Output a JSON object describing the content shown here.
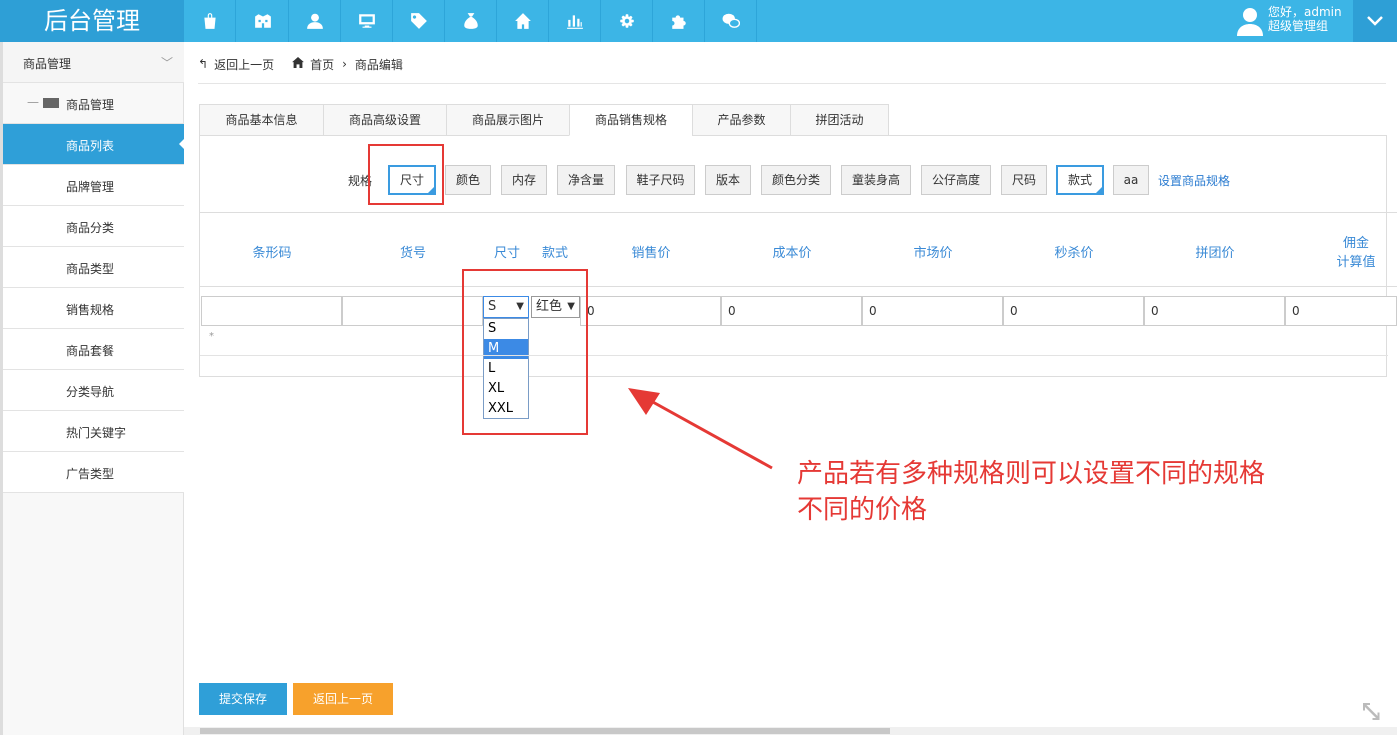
{
  "app": {
    "title": "后台管理"
  },
  "topnav": {
    "icons": [
      "shopping-bag-icon",
      "building-icon",
      "user-icon",
      "monitor-icon",
      "tag-icon",
      "money-bag-icon",
      "home-icon",
      "bar-chart-icon",
      "gear-icon",
      "puzzle-icon",
      "wechat-icon"
    ]
  },
  "user": {
    "greeting": "您好，admin",
    "role": "超级管理组"
  },
  "sidebar": {
    "section": "商品管理",
    "group": "商品管理",
    "items": [
      {
        "label": "商品列表",
        "active": true
      },
      {
        "label": "品牌管理"
      },
      {
        "label": "商品分类"
      },
      {
        "label": "商品类型"
      },
      {
        "label": "销售规格"
      },
      {
        "label": "商品套餐"
      },
      {
        "label": "分类导航"
      },
      {
        "label": "热门关键字"
      },
      {
        "label": "广告类型"
      }
    ]
  },
  "breadcrumb": {
    "back": "返回上一页",
    "home": "首页",
    "sep": "›",
    "current": "商品编辑"
  },
  "tabs": [
    "商品基本信息",
    "商品高级设置",
    "商品展示图片",
    "商品销售规格",
    "产品参数",
    "拼团活动"
  ],
  "active_tab": "商品销售规格",
  "spec": {
    "label": "规格",
    "options": [
      "尺寸",
      "颜色",
      "内存",
      "净含量",
      "鞋子尺码",
      "版本",
      "颜色分类",
      "童装身高",
      "公仔高度",
      "尺码",
      "款式",
      "aa"
    ],
    "selected": [
      "尺寸",
      "款式"
    ],
    "set_link": "设置商品规格"
  },
  "grid": {
    "headers": [
      "条形码",
      "货号",
      "尺寸",
      "款式",
      "销售价",
      "成本价",
      "市场价",
      "秒杀价",
      "拼团价",
      "佣金",
      "计算值"
    ],
    "row": {
      "barcode": "",
      "sku": "",
      "size": "S",
      "style": "红色",
      "sale_price": "0",
      "cost_price": "0",
      "market_price": "0",
      "flash_price": "0",
      "group_price": "0",
      "commission": "0"
    },
    "required_mark": "*",
    "size_options": [
      "S",
      "M",
      "L",
      "XL",
      "XXL"
    ],
    "highlighted_option": "M"
  },
  "annotation": {
    "line1": "产品若有多种规格则可以设置不同的规格",
    "line2": "不同的价格"
  },
  "actions": {
    "save": "提交保存",
    "back": "返回上一页"
  },
  "colors": {
    "topbar": "#3cb5e6",
    "brand": "#2e9fd6",
    "active": "#2f9fd8",
    "orange": "#f7a12c",
    "red": "#e53935",
    "link": "#2a7bd0"
  }
}
